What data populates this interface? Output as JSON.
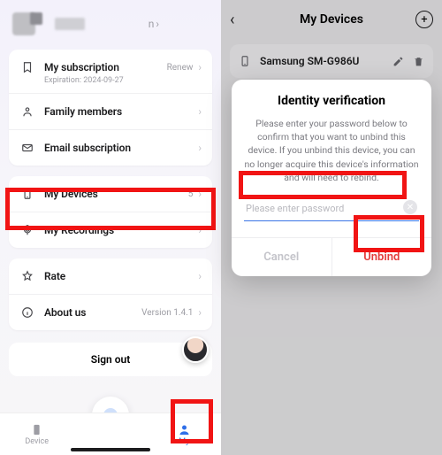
{
  "left": {
    "profile_chevron_count": "n",
    "menu": {
      "subscription": {
        "label": "My subscription",
        "hint": "Renew",
        "sub": "Expiration: 2024-09-27"
      },
      "family": {
        "label": "Family members"
      },
      "email": {
        "label": "Email subscription"
      },
      "devices": {
        "label": "My Devices",
        "count": "5"
      },
      "recordings": {
        "label": "My Recordings"
      },
      "rate": {
        "label": "Rate"
      },
      "about": {
        "label": "About us",
        "hint": "Version 1.4.1"
      }
    },
    "signout": "Sign out",
    "tabs": {
      "device": "Device",
      "my": "My"
    }
  },
  "right": {
    "nav_title": "My Devices",
    "device_name": "Samsung SM-G986U",
    "modal": {
      "title": "Identity verification",
      "body": "Please enter your password below to confirm that you want to unbind this device. If you unbind this device, you can no longer acquire this device's information and will need to rebind.",
      "placeholder": "Please enter password",
      "cancel": "Cancel",
      "confirm": "Unbind"
    }
  }
}
